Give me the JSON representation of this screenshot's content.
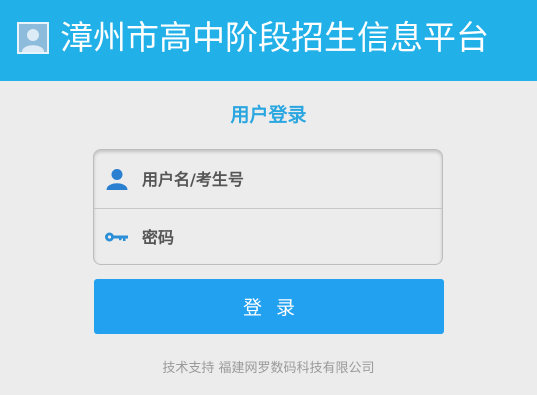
{
  "header": {
    "title": "漳州市高中阶段招生信息平台",
    "logo_icon": "user-avatar-icon",
    "background_color": "#22b0e8"
  },
  "login": {
    "heading": "用户登录",
    "username_placeholder": "用户名/考生号",
    "password_placeholder": "密码",
    "username_icon": "user-icon",
    "password_icon": "key-icon",
    "submit_label": "登录",
    "button_color": "#22a1f0",
    "accent_color": "#2aa6e0"
  },
  "footer": {
    "text": "技术支持 福建网罗数码科技有限公司"
  }
}
